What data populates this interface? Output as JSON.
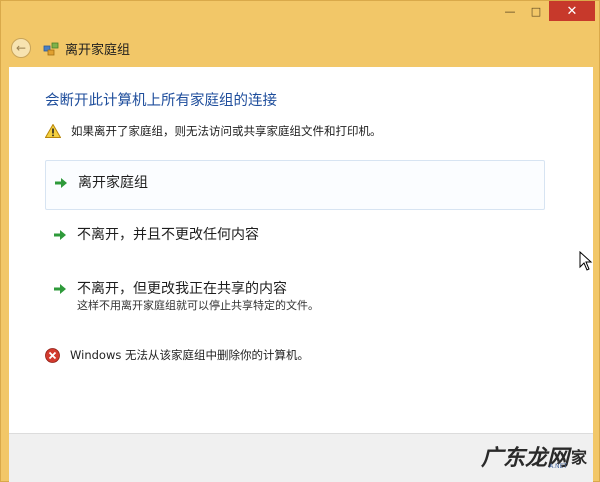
{
  "window": {
    "title": "离开家庭组",
    "controls": {
      "minimize": "—",
      "maximize": "□",
      "close": "✕"
    }
  },
  "content": {
    "heading": "会断开此计算机上所有家庭组的连接",
    "warning": "如果离开了家庭组，则无法访问或共享家庭组文件和打印机。",
    "options": [
      {
        "label": "离开家庭组",
        "sub": ""
      },
      {
        "label": "不离开，并且不更改任何内容",
        "sub": ""
      },
      {
        "label": "不离开，但更改我正在共享的内容",
        "sub": "这样不用离开家庭组就可以停止共享特定的文件。"
      }
    ],
    "error": "Windows 无法从该家庭组中删除你的计算机。"
  },
  "watermark": {
    "text": "广东龙网",
    "suffix": "家",
    "sub": "A.NET"
  },
  "colors": {
    "accent": "#1f4e9c",
    "frame": "#f2c768",
    "close": "#c7392b",
    "arrow": "#2e9a3a"
  }
}
